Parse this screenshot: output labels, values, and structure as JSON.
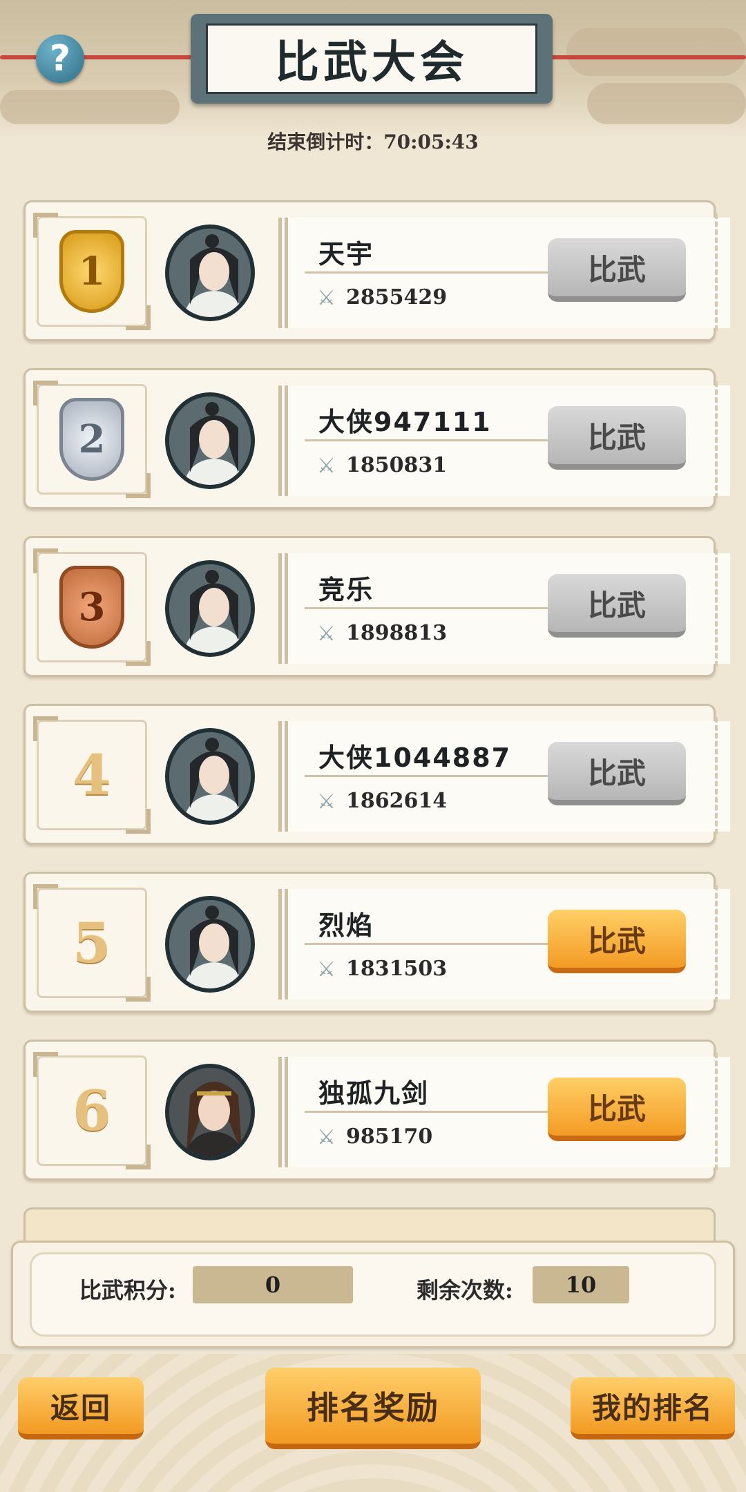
{
  "header": {
    "title": "比武大会",
    "help_icon": "question-icon",
    "countdown": "结束倒计时：70:05:43"
  },
  "players": [
    {
      "rank": "1",
      "medal": "gold",
      "name": "天宇",
      "power": "2855429",
      "button": "比武",
      "button_style": "gray"
    },
    {
      "rank": "2",
      "medal": "silver",
      "name": "大侠947111",
      "power": "1850831",
      "button": "比武",
      "button_style": "gray"
    },
    {
      "rank": "3",
      "medal": "bronze",
      "name": "竞乐",
      "power": "1898813",
      "button": "比武",
      "button_style": "gray"
    },
    {
      "rank": "4",
      "medal": "",
      "name": "大侠1044887",
      "power": "1862614",
      "button": "比武",
      "button_style": "gray"
    },
    {
      "rank": "5",
      "medal": "",
      "name": "烈焰",
      "power": "1831503",
      "button": "比武",
      "button_style": "orange"
    },
    {
      "rank": "6",
      "medal": "",
      "name": "独孤九剑",
      "power": "985170",
      "button": "比武",
      "button_style": "orange"
    }
  ],
  "stats": {
    "score_label": "比武积分:",
    "score_value": "0",
    "remaining_label": "剩余次数:",
    "remaining_value": "10"
  },
  "footer": {
    "back": "返回",
    "rank_reward": "排名奖励",
    "my_rank": "我的排名"
  },
  "colors": {
    "gray_button": "#c8c8c8",
    "orange_button": "#f7b13f",
    "gold_medal": "#e2a92a",
    "silver_medal": "#b8c0cc",
    "bronze_medal": "#c97946"
  }
}
